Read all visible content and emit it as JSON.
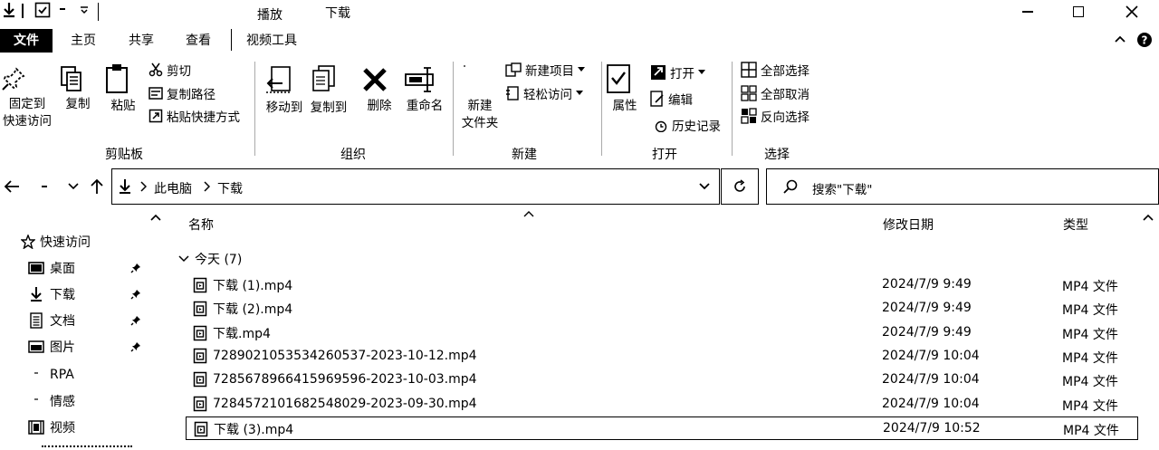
{
  "titlebar": {
    "context_tab": "播放",
    "title": "下载"
  },
  "tabs": {
    "file": "文件",
    "home": "主页",
    "share": "共享",
    "view": "查看",
    "video_tools": "视频工具"
  },
  "ribbon": {
    "clipboard": {
      "pin_quick_access": [
        "固定到",
        "快速访问"
      ],
      "copy": "复制",
      "paste": "粘贴",
      "cut": "剪切",
      "copy_path": "复制路径",
      "paste_shortcut": "粘贴快捷方式",
      "label": "剪贴板"
    },
    "organize": {
      "move_to": "移动到",
      "copy_to": "复制到",
      "delete": "删除",
      "rename": "重命名",
      "label": "组织"
    },
    "new": {
      "new_item": "新建项目",
      "easy_access": "轻松访问",
      "new_folder": [
        "新建",
        "文件夹"
      ],
      "label": "新建"
    },
    "open": {
      "properties": "属性",
      "open": "打开",
      "edit": "编辑",
      "history": "历史记录",
      "label": "打开"
    },
    "select": {
      "select_all": "全部选择",
      "select_none": "全部取消",
      "invert": "反向选择",
      "label": "选择"
    }
  },
  "address": {
    "crumb1": "此电脑",
    "crumb2": "下载"
  },
  "search": {
    "placeholder": "搜索\"下载\""
  },
  "nav": {
    "quick_access": "快速访问",
    "items": [
      {
        "label": "桌面",
        "icon": "desktop-icon",
        "pinned": true
      },
      {
        "label": "下载",
        "icon": "download-icon",
        "pinned": true
      },
      {
        "label": "文档",
        "icon": "document-icon",
        "pinned": true
      },
      {
        "label": "图片",
        "icon": "picture-icon",
        "pinned": true
      },
      {
        "label": "RPA",
        "icon": "folder-icon",
        "pinned": false
      },
      {
        "label": "情感",
        "icon": "folder-icon",
        "pinned": false
      },
      {
        "label": "视频",
        "icon": "video-icon",
        "pinned": false
      }
    ]
  },
  "columns": {
    "name": "名称",
    "date": "修改日期",
    "type": "类型"
  },
  "group": {
    "label": "今天 (7)"
  },
  "files": [
    {
      "name": "下载 (1).mp4",
      "date": "2024/7/9 9:49",
      "type": "MP4 文件"
    },
    {
      "name": "下载 (2).mp4",
      "date": "2024/7/9 9:49",
      "type": "MP4 文件"
    },
    {
      "name": "下载.mp4",
      "date": "2024/7/9 9:49",
      "type": "MP4 文件"
    },
    {
      "name": "7289021053534260537-2023-10-12.mp4",
      "date": "2024/7/9 10:04",
      "type": "MP4 文件"
    },
    {
      "name": "7285678966415969596-2023-10-03.mp4",
      "date": "2024/7/9 10:04",
      "type": "MP4 文件"
    },
    {
      "name": "7284572101682548029-2023-09-30.mp4",
      "date": "2024/7/9 10:04",
      "type": "MP4 文件"
    },
    {
      "name": "下载 (3).mp4",
      "date": "2024/7/9 10:52",
      "type": "MP4 文件",
      "selected": true
    }
  ]
}
